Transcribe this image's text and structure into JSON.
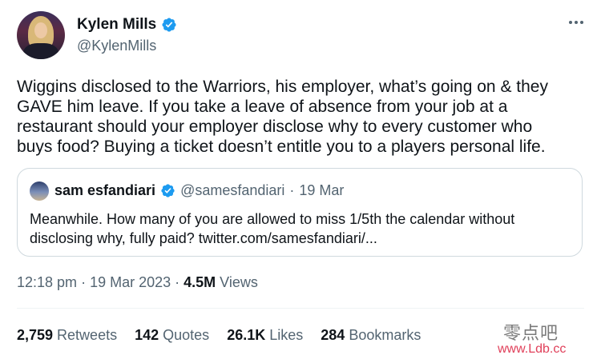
{
  "author": {
    "name": "Kylen Mills",
    "handle": "@KylenMills",
    "verified": true,
    "avatar_icon": "user-avatar"
  },
  "tweet": {
    "text": "Wiggins disclosed to the Warriors, his employer, what’s going on & they\nGAVE him leave. If you take a leave of absence from your job at a\nrestaurant should your employer disclose why to every customer who\nbuys food? Buying a ticket doesn’t entitle you to a players personal life."
  },
  "quoted": {
    "name": "sam esfandiari",
    "handle": "@samesfandiari",
    "dot": "·",
    "date": "19 Mar",
    "text": "Meanwhile. How many of you are allowed to miss 1/5th the calendar without\ndisclosing why, fully paid? twitter.com/samesfandiari/..."
  },
  "meta": {
    "time": "12:18 pm",
    "sep1": "·",
    "date": "19 Mar 2023",
    "sep2": "·",
    "views_count": "4.5M",
    "views_label": "Views"
  },
  "stats": {
    "retweets": {
      "count": "2,759",
      "label": "Retweets"
    },
    "quotes": {
      "count": "142",
      "label": "Quotes"
    },
    "likes": {
      "count": "26.1K",
      "label": "Likes"
    },
    "bookmarks": {
      "count": "284",
      "label": "Bookmarks"
    }
  },
  "watermark": {
    "line1": "零点吧",
    "line2": "www.Ldb.cc"
  },
  "colors": {
    "verified_blue": "#1d9bf0",
    "secondary_text": "#536471",
    "border": "#cfd9de"
  }
}
